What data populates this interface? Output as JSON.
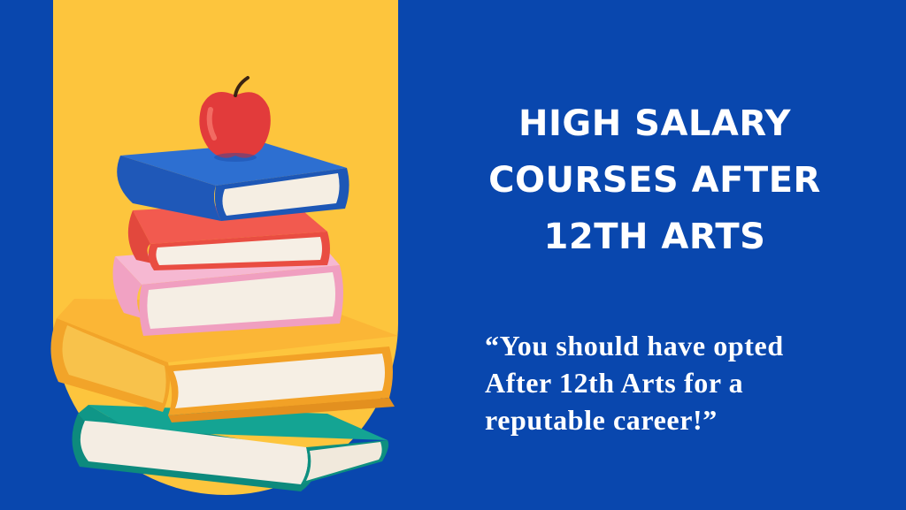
{
  "headline": {
    "line1": "HIGH SALARY",
    "line2": "COURSES AFTER",
    "line3": "12TH ARTS"
  },
  "quote": {
    "line1": "“You should have opted",
    "line2": "After 12th Arts for a",
    "line3": "reputable career!”"
  },
  "colors": {
    "background": "#0947ae",
    "accent_yellow": "#fdc53d",
    "text": "#ffffff"
  },
  "icons": [
    "apple-icon",
    "book-stack-icon"
  ]
}
